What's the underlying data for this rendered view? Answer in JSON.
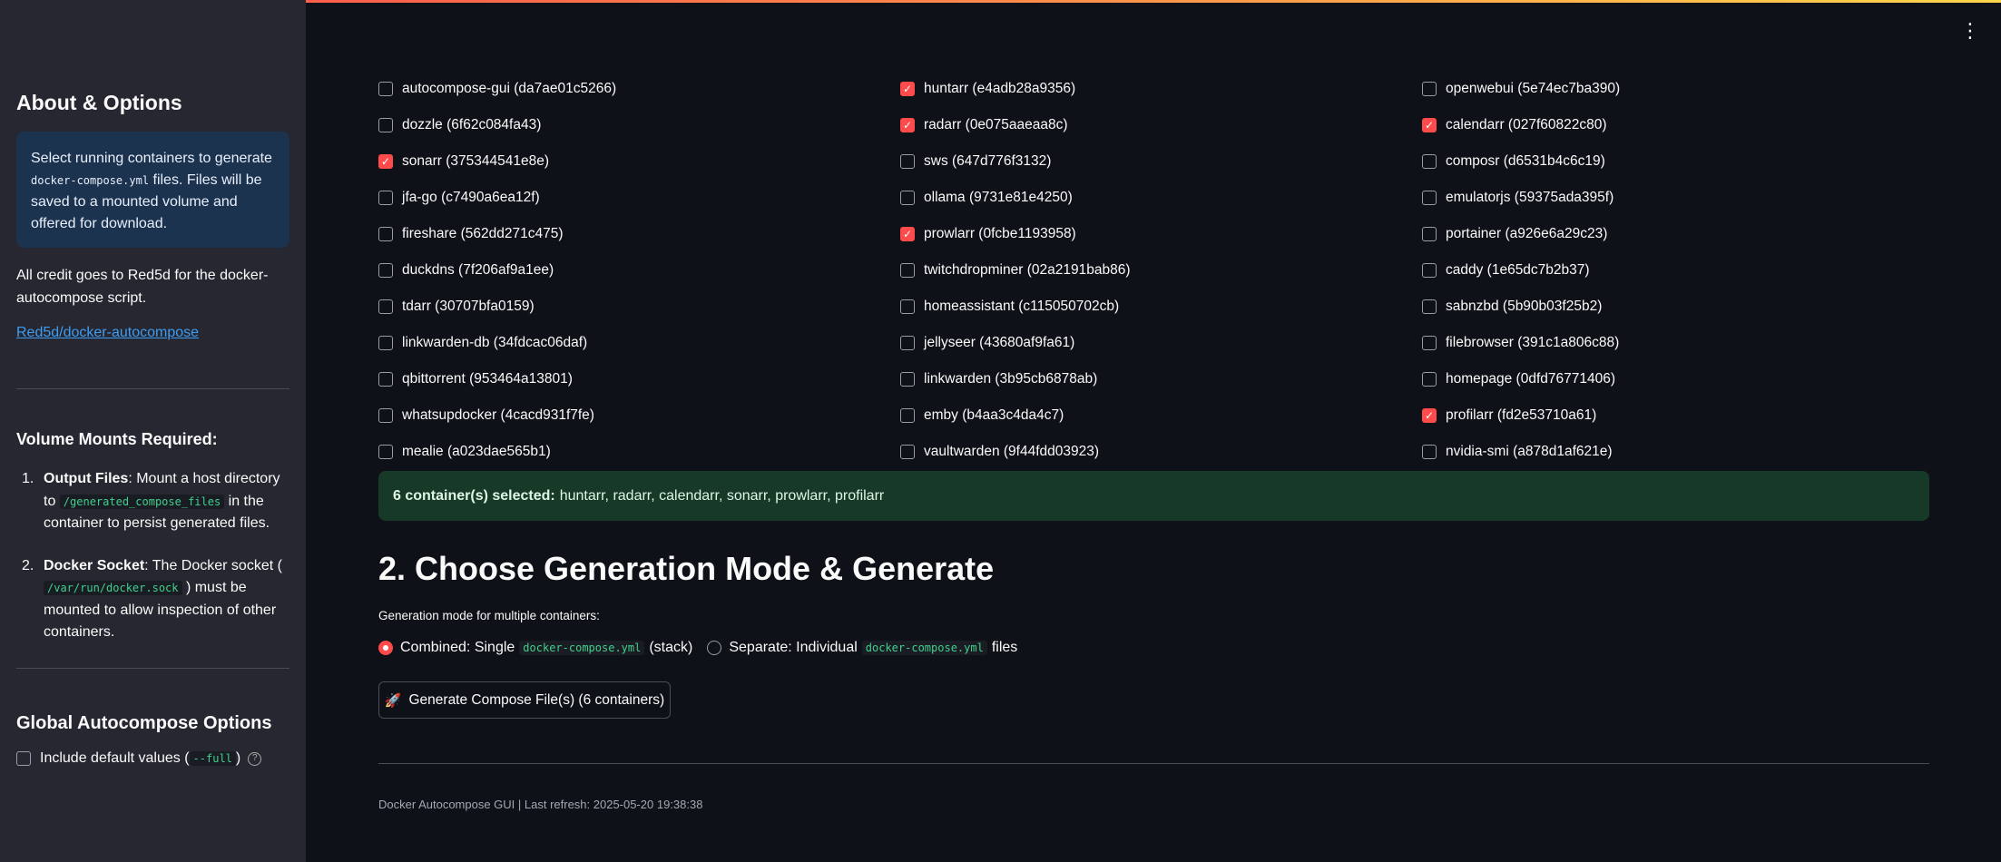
{
  "sidebar": {
    "title": "About & Options",
    "info": {
      "text_before": "Select running containers to generate ",
      "code": "docker-compose.yml",
      "text_after": " files. Files will be saved to a mounted volume and offered for download."
    },
    "credit": "All credit goes to Red5d for the docker-autocompose script.",
    "repo_link": "Red5d/docker-autocompose",
    "volume_title": "Volume Mounts Required:",
    "volumes": [
      {
        "num": "1.",
        "label": "Output Files",
        "text_before": ": Mount a host directory to ",
        "code": "/generated_compose_files",
        "text_after": " in the container to persist generated files."
      },
      {
        "num": "2.",
        "label": "Docker Socket",
        "text_before": ": The Docker socket ( ",
        "code": "/var/run/docker.sock",
        "text_after": " ) must be mounted to allow inspection of other containers."
      }
    ],
    "global_title": "Global Autocompose Options",
    "include_defaults": {
      "label_before": "Include default values ( ",
      "code": "--full",
      "label_after": " )",
      "checked": false
    }
  },
  "containers": [
    {
      "label": "autocompose-gui (da7ae01c5266)",
      "checked": false
    },
    {
      "label": "huntarr (e4adb28a9356)",
      "checked": true
    },
    {
      "label": "openwebui (5e74ec7ba390)",
      "checked": false
    },
    {
      "label": "dozzle (6f62c084fa43)",
      "checked": false
    },
    {
      "label": "radarr (0e075aaeaa8c)",
      "checked": true
    },
    {
      "label": "calendarr (027f60822c80)",
      "checked": true
    },
    {
      "label": "sonarr (375344541e8e)",
      "checked": true
    },
    {
      "label": "sws (647d776f3132)",
      "checked": false
    },
    {
      "label": "composr (d6531b4c6c19)",
      "checked": false
    },
    {
      "label": "jfa-go (c7490a6ea12f)",
      "checked": false
    },
    {
      "label": "ollama (9731e81e4250)",
      "checked": false
    },
    {
      "label": "emulatorjs (59375ada395f)",
      "checked": false
    },
    {
      "label": "fireshare (562dd271c475)",
      "checked": false
    },
    {
      "label": "prowlarr (0fcbe1193958)",
      "checked": true
    },
    {
      "label": "portainer (a926e6a29c23)",
      "checked": false
    },
    {
      "label": "duckdns (7f206af9a1ee)",
      "checked": false
    },
    {
      "label": "twitchdropminer (02a2191bab86)",
      "checked": false
    },
    {
      "label": "caddy (1e65dc7b2b37)",
      "checked": false
    },
    {
      "label": "tdarr (30707bfa0159)",
      "checked": false
    },
    {
      "label": "homeassistant (c115050702cb)",
      "checked": false
    },
    {
      "label": "sabnzbd (5b90b03f25b2)",
      "checked": false
    },
    {
      "label": "linkwarden-db (34fdcac06daf)",
      "checked": false
    },
    {
      "label": "jellyseer (43680af9fa61)",
      "checked": false
    },
    {
      "label": "filebrowser (391c1a806c88)",
      "checked": false
    },
    {
      "label": "qbittorrent (953464a13801)",
      "checked": false
    },
    {
      "label": "linkwarden (3b95cb6878ab)",
      "checked": false
    },
    {
      "label": "homepage (0dfd76771406)",
      "checked": false
    },
    {
      "label": "whatsupdocker (4cacd931f7fe)",
      "checked": false
    },
    {
      "label": "emby (b4aa3c4da4c7)",
      "checked": false
    },
    {
      "label": "profilarr (fd2e53710a61)",
      "checked": true
    },
    {
      "label": "mealie (a023dae565b1)",
      "checked": false
    },
    {
      "label": "vaultwarden (9f44fdd03923)",
      "checked": false
    },
    {
      "label": "nvidia-smi (a878d1af621e)",
      "checked": false
    }
  ],
  "selection": {
    "count_label": "6 container(s) selected:",
    "names": "huntarr, radarr, calendarr, sonarr, prowlarr, profilarr"
  },
  "generation": {
    "title": "2. Choose Generation Mode & Generate",
    "mode_label": "Generation mode for multiple containers:",
    "combined": {
      "before": "Combined: Single",
      "code": "docker-compose.yml",
      "after": "(stack)",
      "selected": true
    },
    "separate": {
      "before": "Separate: Individual",
      "code": "docker-compose.yml",
      "after": "files",
      "selected": false
    },
    "button_label": "Generate Compose File(s) (6 containers)",
    "button_icon": "rocket-icon"
  },
  "footer": "Docker Autocompose GUI | Last refresh: 2025-05-20 19:38:38",
  "colors": {
    "accent": "#ff4b4b",
    "sidebar_bg": "#262730",
    "main_bg": "#0e1117",
    "info_bg": "#1c3350",
    "success_bg": "#173928",
    "link": "#3d9df3",
    "code_text": "#3fd08c"
  }
}
